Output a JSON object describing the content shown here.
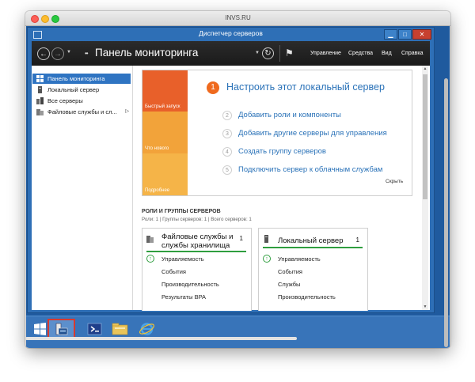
{
  "mac_window": {
    "title": "INVS.RU"
  },
  "server_manager": {
    "title": "Диспетчер серверов",
    "window_buttons": {
      "minimize": "▁",
      "maximize": "□",
      "close": "✕"
    },
    "header": {
      "breadcrumb_prefix": "••",
      "title": "Панель мониторинга",
      "menu": [
        "Управление",
        "Средства",
        "Вид",
        "Справка"
      ]
    },
    "nav": {
      "items": [
        {
          "label": "Панель мониторинга",
          "icon": "dashboard-icon",
          "selected": true
        },
        {
          "label": "Локальный сервер",
          "icon": "local-server-icon"
        },
        {
          "label": "Все серверы",
          "icon": "all-servers-icon"
        },
        {
          "label": "Файловые службы и сл...",
          "icon": "file-services-icon",
          "arrow": "▷"
        }
      ]
    },
    "quick_start": {
      "tiles": [
        "Быстрый запуск",
        "Что нового",
        "Подробнее"
      ],
      "main_step": {
        "number": "1",
        "label": "Настроить этот локальный сервер"
      },
      "steps": [
        {
          "number": "2",
          "label": "Добавить роли и компоненты"
        },
        {
          "number": "3",
          "label": "Добавить другие серверы для управления"
        },
        {
          "number": "4",
          "label": "Создать группу серверов"
        },
        {
          "number": "5",
          "label": "Подключить сервер к облачным службам"
        }
      ],
      "hide_label": "Скрыть"
    },
    "roles": {
      "heading": "РОЛИ И ГРУППЫ СЕРВЕРОВ",
      "subtitle": "Роли: 1 | Группы серверов: 1 | Всего серверов: 1",
      "cards": [
        {
          "title": "Файловые службы и службы хранилища",
          "count": "1",
          "rows": [
            "Управляемость",
            "События",
            "Производительность",
            "Результаты BPA"
          ]
        },
        {
          "title": "Локальный сервер",
          "count": "1",
          "rows": [
            "Управляемость",
            "События",
            "Службы",
            "Производительность"
          ]
        }
      ]
    }
  },
  "taskbar": {
    "items": [
      "windows-start-icon",
      "server-manager-icon",
      "powershell-icon",
      "file-explorer-icon",
      "internet-explorer-icon"
    ]
  },
  "colors": {
    "window_frame": "#2e6fb6",
    "header_bg": "#1a1a1a",
    "accent_orange": "#e8602a",
    "link_blue": "#2a72b8",
    "status_green": "#2f9e3f",
    "taskbar": "#3874b9",
    "highlight_red": "#d73a2f"
  }
}
